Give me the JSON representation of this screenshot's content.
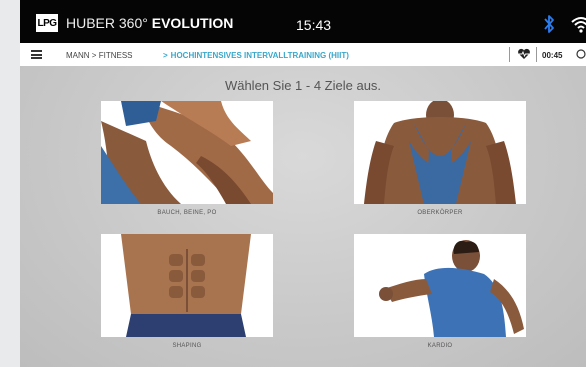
{
  "status_bar": {
    "logo_text": "LPG",
    "brand_prefix": "HUBER 360°",
    "brand_suffix": "EVOLUTION",
    "time": "15:43",
    "icons": [
      "bluetooth-icon",
      "wifi-icon"
    ],
    "bluetooth_color": "#2a7df0"
  },
  "nav_bar": {
    "menu_icon": "hamburger-menu-icon",
    "breadcrumb": [
      "MANN",
      "FITNESS"
    ],
    "breadcrumb_separator": ">",
    "current": "HOCHINTENSIVES INTERVALLTRAINING (HIIT)",
    "accent_color": "#3aa7c9",
    "heart_icon": "heart-monitor-icon",
    "timer": "00:45"
  },
  "main": {
    "instruction": "Wählen Sie 1 - 4 Ziele aus.",
    "goals": [
      {
        "label": "BAUCH, BEINE, PO",
        "image": "legs-lunge-photo"
      },
      {
        "label": "OBERKÖRPER",
        "image": "back-muscles-photo"
      },
      {
        "label": "SHAPING",
        "image": "abs-photo"
      },
      {
        "label": "KARDIO",
        "image": "runner-photo"
      }
    ]
  }
}
